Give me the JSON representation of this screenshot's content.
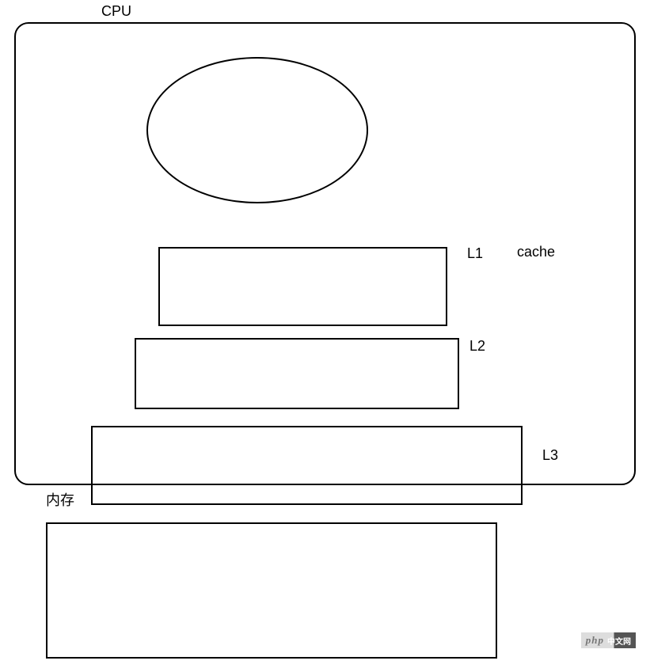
{
  "labels": {
    "cpu": "CPU",
    "l1": "L1",
    "cache": "cache",
    "l2": "L2",
    "l3": "L3",
    "memory": "内存"
  },
  "watermark": {
    "brand": "php",
    "suffix": "中文网"
  },
  "diagram": {
    "description": "CPU cache hierarchy diagram",
    "components": [
      {
        "name": "CPU container",
        "shape": "rounded-rectangle"
      },
      {
        "name": "CPU core",
        "shape": "ellipse"
      },
      {
        "name": "L1 cache",
        "shape": "rectangle",
        "level": 1
      },
      {
        "name": "L2 cache",
        "shape": "rectangle",
        "level": 2
      },
      {
        "name": "L3 cache",
        "shape": "rectangle",
        "level": 3
      },
      {
        "name": "Memory (内存)",
        "shape": "rectangle"
      }
    ]
  }
}
